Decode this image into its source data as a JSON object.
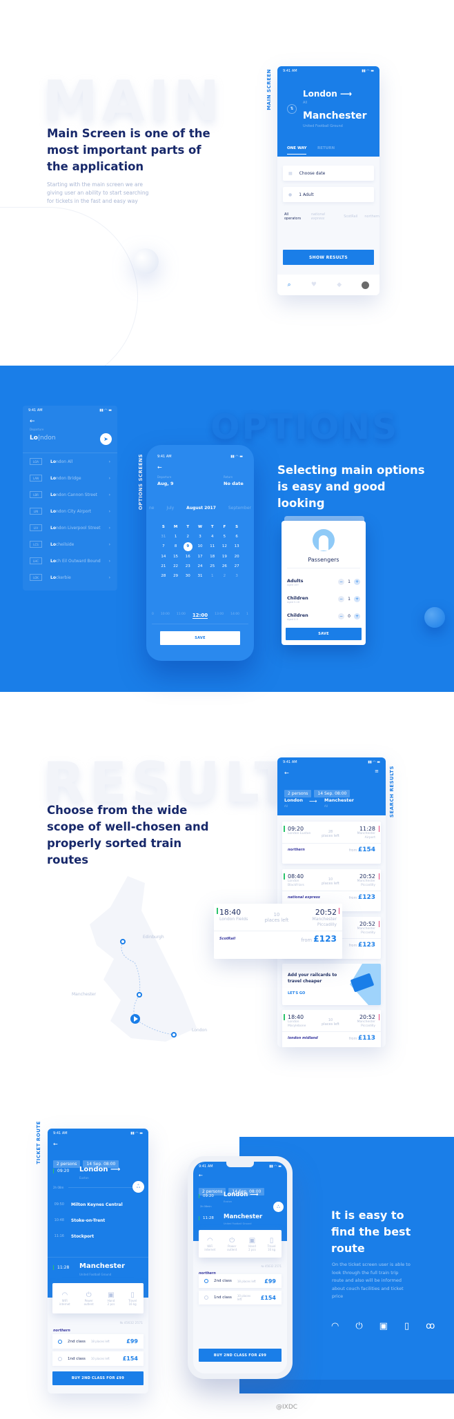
{
  "colors": {
    "accent": "#1a7ee8",
    "heading": "#17286a",
    "muted": "#a9b6d3",
    "green": "#2ac36b",
    "pink": "#e5447b"
  },
  "section_main": {
    "ghost": "MAIN",
    "vertical_label": "MAIN SCREEN",
    "heading": "Main Screen is one of the most important parts of the application",
    "paragraph": "Starting with the main screen we are giving user an ability to start searching for tickets in the fast and easy way",
    "phone": {
      "time": "9:41 AM",
      "from_city": "London",
      "from_sub": "All",
      "to_city": "Manchester",
      "to_sub": "United Football Ground",
      "tabs": [
        "ONE WAY",
        "RETURN"
      ],
      "date_placeholder": "Choose date",
      "passengers": "1 Adult",
      "operators_label": "All operators",
      "operators": [
        "national express",
        "ScotRail",
        "northern"
      ],
      "show_button": "SHOW RESULTS",
      "nav_icons": [
        "search-icon",
        "heart-icon",
        "ticket-icon",
        "avatar"
      ]
    }
  },
  "section_options": {
    "ghost": "OPTIONS",
    "vertical_label": "OPTIONS SCREENS",
    "heading": "Selecting main options is easy and good looking",
    "search_phone": {
      "time": "9:41 AM",
      "label": "Departure",
      "query_typed": "Lo",
      "query_rest": "ndon",
      "stations": [
        {
          "code": "LOA",
          "match": "Lo",
          "rest": "ndon All"
        },
        {
          "code": "LAN",
          "match": "Lo",
          "rest": "ndon Bridge"
        },
        {
          "code": "LBR",
          "match": "Lo",
          "rest": "ndon Cannon Street"
        },
        {
          "code": "LIN",
          "match": "Lo",
          "rest": "ndon City Airport"
        },
        {
          "code": "LIV",
          "match": "Lo",
          "rest": "ndon Liverpool Street"
        },
        {
          "code": "LCS",
          "match": "Lo",
          "rest": "cheilside"
        },
        {
          "code": "LHC",
          "match": "Lo",
          "rest": "ch Eil Outward Bound"
        },
        {
          "code": "LOK",
          "match": "Lo",
          "rest": "ckerbie"
        }
      ]
    },
    "calendar_phone": {
      "time": "9:41 AM",
      "departure_label": "Departure",
      "departure_value": "Aug, 9",
      "return_label": "Return",
      "return_value": "No date",
      "months": [
        "ne",
        "July",
        "August 2017",
        "September"
      ],
      "weekdays": [
        "S",
        "M",
        "T",
        "W",
        "T",
        "F",
        "S"
      ],
      "days": [
        "31",
        "1",
        "2",
        "3",
        "4",
        "5",
        "6",
        "7",
        "8",
        "9",
        "10",
        "11",
        "12",
        "13",
        "14",
        "15",
        "16",
        "17",
        "18",
        "19",
        "20",
        "21",
        "22",
        "23",
        "24",
        "25",
        "26",
        "27",
        "28",
        "29",
        "30",
        "31",
        "1",
        "2",
        "3"
      ],
      "selected_day": "9",
      "times": [
        "0",
        "10:00",
        "11:00",
        "12:00",
        "13:00",
        "14:00",
        "1"
      ],
      "selected_time": "12:00",
      "save": "SAVE"
    },
    "passengers_card": {
      "title": "Passengers",
      "rows": [
        {
          "label": "Adults",
          "sub": "Aged 16+",
          "value": "1"
        },
        {
          "label": "Children",
          "sub": "Aged 5-16",
          "value": "1"
        },
        {
          "label": "Children",
          "sub": "Aged 0-5",
          "value": "0"
        }
      ],
      "save": "SAVE"
    }
  },
  "section_result": {
    "ghost": "RESULT",
    "vertical_label": "SEARCH RESULTS",
    "heading": "Choose from the wide scope of well-chosen and properly sorted train routes",
    "map_labels": [
      "Edinburgh",
      "Manchester",
      "London"
    ],
    "phone": {
      "time": "9:41 AM",
      "chips": [
        "2 persons",
        "14 Sep. 08:00"
      ],
      "from": "London",
      "from_sub": "All",
      "to": "Manchester",
      "to_sub": "All",
      "results": [
        {
          "dep": "09:20",
          "dep_st": "London Euston",
          "places": "28",
          "places_label": "places left",
          "arr": "11:28",
          "arr_st": "Manchester Airport",
          "operator": "northern",
          "from": "from",
          "price": "£154"
        },
        {
          "dep": "08:40",
          "dep_st": "London Blackfriars",
          "places": "10",
          "places_label": "places left",
          "arr": "20:52",
          "arr_st": "Manchester Piccadilly",
          "operator": "national express",
          "from": "from",
          "price": "£123"
        },
        {
          "dep": "",
          "dep_st": "",
          "places": "",
          "places_label": "",
          "arr": "20:52",
          "arr_st": "Manchester Piccadilly",
          "operator": "",
          "from": "from",
          "price": "£123"
        }
      ],
      "promo": {
        "title": "Add your railcards to travel cheaper",
        "cta": "LET'S GO"
      },
      "last": {
        "dep": "18:40",
        "dep_st": "London Marylebone",
        "places": "10",
        "places_label": "places left",
        "arr": "20:52",
        "arr_st": "Manchester Piccadilly",
        "operator": "london midland",
        "from": "from",
        "price": "£113"
      }
    },
    "popup": {
      "dep": "18:40",
      "dep_st": "London Fields",
      "places": "10",
      "places_label": "places left",
      "arr": "20:52",
      "arr_st": "Manchester Piccadilly",
      "operator": "ScotRail",
      "from": "from",
      "price": "£123"
    }
  },
  "section_route": {
    "vertical_label": "TICKET ROUTE",
    "heading": "It is easy to find the best route",
    "paragraph": "On the ticket screen user is able to look through the full train trip route and also will be informed about couch facilities and ticket price",
    "feature_icons": [
      "wifi-icon",
      "power-icon",
      "luggage-icon",
      "bottle-icon",
      "bike-icon"
    ],
    "phone": {
      "time": "9:41 AM",
      "chips": [
        "2 persons",
        "14 Sep. 08:00"
      ],
      "dep_time": "09:20",
      "dep_city": "London",
      "dep_sub": "Euston",
      "duration": "2h 08m",
      "duration_short": "2h 08min",
      "stops": [
        {
          "time": "09:50",
          "name": "Milton Keynes Central"
        },
        {
          "time": "10:48",
          "name": "Stoke-on-Trent"
        },
        {
          "time": "11:16",
          "name": "Stockport"
        }
      ],
      "arr_time": "11:28",
      "arr_city": "Manchester",
      "arr_sub": "United Football Ground",
      "amenities": [
        {
          "icon": "wifi-icon",
          "l1": "WiFi",
          "l2": "internet"
        },
        {
          "icon": "power-icon",
          "l1": "Power",
          "l2": "outlent"
        },
        {
          "icon": "luggage-icon",
          "l1": "Hand",
          "l2": "2 pcs"
        },
        {
          "icon": "bottle-icon",
          "l1": "Travel",
          "l2": "16 kg"
        }
      ],
      "operator": "northern",
      "ticket_no": "№ 45632 2571",
      "classes": [
        {
          "name": "2nd class",
          "places": "18 places left",
          "price": "£99",
          "selected": true
        },
        {
          "name": "1nd class",
          "places": "10 places left",
          "price": "£154",
          "selected": false
        }
      ],
      "buy": "BUY 2ND CLASS FOR £99"
    }
  },
  "watermark": "@IXDC"
}
